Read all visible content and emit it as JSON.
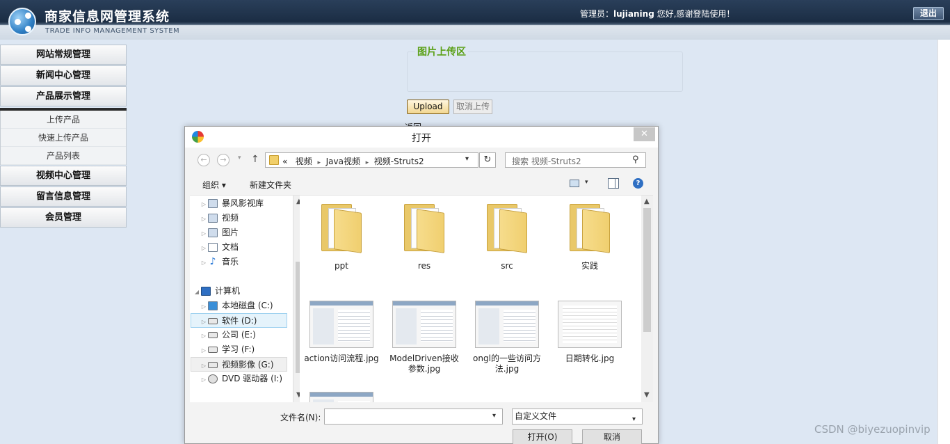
{
  "header": {
    "title_cn": "商家信息网管理系统",
    "title_en": "TRADE INFO MANAGEMENT SYSTEM",
    "admin_prefix": "管理员：",
    "admin_name": "lujianing",
    "admin_suffix": " 您好,感谢登陆使用！",
    "logout_label": "退出"
  },
  "menu": {
    "items": [
      {
        "label": "网站常规管理"
      },
      {
        "label": "新闻中心管理"
      },
      {
        "label": "产品展示管理"
      }
    ],
    "sub_items": [
      {
        "label": "上传产品"
      },
      {
        "label": "快速上传产品"
      },
      {
        "label": "产品列表"
      }
    ],
    "items_after": [
      {
        "label": "视频中心管理"
      },
      {
        "label": "留言信息管理"
      },
      {
        "label": "会员管理"
      }
    ]
  },
  "upload": {
    "legend": "图片上传区",
    "upload_label": "Upload",
    "cancel_label": "取消上传",
    "back_label": "返回"
  },
  "dialog": {
    "title": "打开",
    "close_glyph": "✕",
    "path_prefix": "«",
    "path_segments": [
      "视频",
      "Java视频",
      "视频-Struts2"
    ],
    "search_placeholder": "搜索 视频-Struts2",
    "toolbar": {
      "organize": "组织 ▾",
      "new_folder": "新建文件夹"
    },
    "tree": [
      {
        "label": "暴风影视库",
        "icon": "video-library-icon"
      },
      {
        "label": "视频",
        "icon": "video-icon"
      },
      {
        "label": "图片",
        "icon": "picture-icon"
      },
      {
        "label": "文档",
        "icon": "document-icon"
      },
      {
        "label": "音乐",
        "icon": "music-icon"
      },
      {
        "label": "计算机",
        "icon": "computer-icon"
      },
      {
        "label": "本地磁盘 (C:)",
        "icon": "drive-icon"
      },
      {
        "label": "软件 (D:)",
        "icon": "drive-icon"
      },
      {
        "label": "公司 (E:)",
        "icon": "drive-icon"
      },
      {
        "label": "学习 (F:)",
        "icon": "drive-icon"
      },
      {
        "label": "视频影像 (G:)",
        "icon": "drive-icon"
      },
      {
        "label": "DVD 驱动器 (I:)",
        "icon": "dvd-icon"
      }
    ],
    "files": [
      {
        "name": "ppt",
        "kind": "folder"
      },
      {
        "name": "res",
        "kind": "folder"
      },
      {
        "name": "src",
        "kind": "folder"
      },
      {
        "name": "实践",
        "kind": "folder"
      },
      {
        "name": "action访问流程.jpg",
        "kind": "image"
      },
      {
        "name": "ModelDriven接收参数.jpg",
        "kind": "image"
      },
      {
        "name": "ongl的一些访问方法.jpg",
        "kind": "image"
      },
      {
        "name": "日期转化.jpg",
        "kind": "image"
      }
    ],
    "filename_label": "文件名(N):",
    "filename_value": "",
    "filetype_value": "自定义文件",
    "open_label": "打开(O)",
    "cancel_label": "取消"
  },
  "watermark": "CSDN @biyezuopinvip"
}
